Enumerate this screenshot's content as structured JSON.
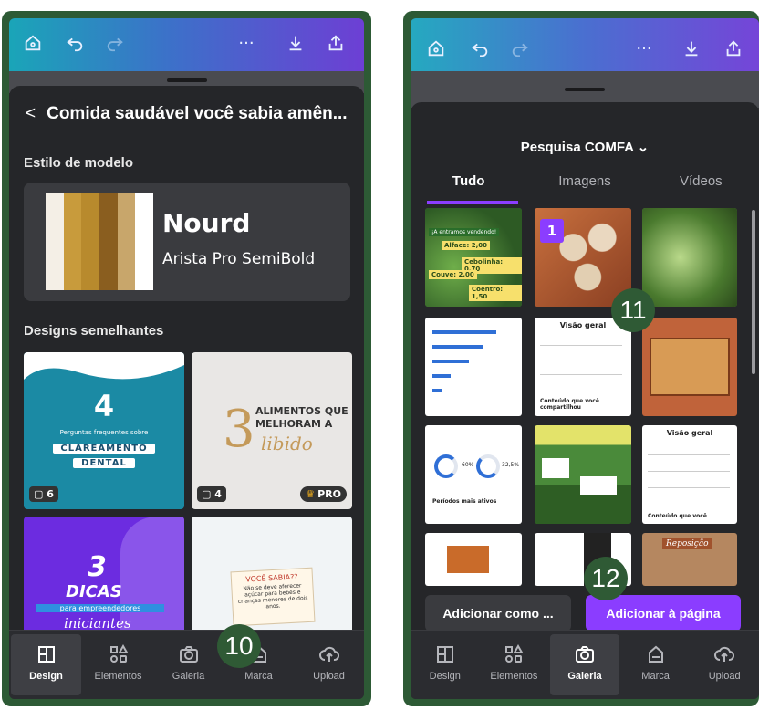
{
  "left": {
    "appbar_icons": [
      "home-icon",
      "undo-icon",
      "redo-icon",
      "more-icon",
      "download-icon",
      "share-icon"
    ],
    "more_glyph": "···",
    "title": "Comida saudável você sabia amên...",
    "back_glyph": "<",
    "style_section": "Estilo de modelo",
    "style_name": "Nourd",
    "style_font": "Arista Pro SemiBold",
    "swatch_colors": [
      "#f4efe6",
      "#c89b3c",
      "#b88a2d",
      "#8a5e1f",
      "#c8a66b",
      "#ffffff"
    ],
    "similar_section": "Designs semelhantes",
    "tiles": [
      {
        "title_num": "4",
        "subtitle": "Perguntas frequentes sobre",
        "label1": "CLAREAMENTO",
        "label2": "DENTAL",
        "badge": "6",
        "bg": "#1b8aa4"
      },
      {
        "title_num": "3",
        "line1": "ALIMENTOS QUE",
        "line2": "MELHORAM A",
        "line3": "libido",
        "badge": "4",
        "pro": "PRO",
        "bg": "#e9e7e5"
      },
      {
        "title_num": "3",
        "line1": "DICAS",
        "line2": "para empreendedores",
        "line3": "iniciantes",
        "bg": "#6c2ce0"
      },
      {
        "label": "VOCÊ SABIA??",
        "text": "Não se deve aferecer açúcar para bebês e crianças menores de dois anos.",
        "bg": "#f1f4f6"
      }
    ],
    "tabs": [
      {
        "label": "Design",
        "icon": "layout-icon",
        "active": true
      },
      {
        "label": "Elementos",
        "icon": "shapes-icon",
        "active": false
      },
      {
        "label": "Galeria",
        "icon": "camera-icon",
        "active": false
      },
      {
        "label": "Marca",
        "icon": "brand-icon",
        "active": false
      },
      {
        "label": "Upload",
        "icon": "upload-cloud-icon",
        "active": false
      }
    ],
    "marker": "10"
  },
  "right": {
    "search_title": "Pesquisa COMFA",
    "chevron": "⌄",
    "filter_tabs": [
      "Tudo",
      "Imagens",
      "Vídeos"
    ],
    "active_filter": "Tudo",
    "row1_overlay": {
      "heading": "¡A entramos vendendo!",
      "items": [
        "Alface: 2,00",
        "Cebolinha: 0,70",
        "Couve: 2,00",
        "Coentro: 1,50"
      ]
    },
    "selected_number": "1",
    "overview_title": "Visão geral",
    "overview_footer": "Conteúdo que você compartilhou",
    "overview_footer2": "Conteúdo que você",
    "stats_values": [
      "60%",
      "32,5%"
    ],
    "stats_footer": "Períodos mais ativos",
    "reposicao": "Reposição",
    "add_as": "Adicionar como ...",
    "add_page": "Adicionar à página",
    "tabs": [
      {
        "label": "Design",
        "icon": "layout-icon",
        "active": false
      },
      {
        "label": "Elementos",
        "icon": "shapes-icon",
        "active": false
      },
      {
        "label": "Galeria",
        "icon": "camera-icon",
        "active": true
      },
      {
        "label": "Marca",
        "icon": "brand-icon",
        "active": false
      },
      {
        "label": "Upload",
        "icon": "upload-cloud-icon",
        "active": false
      }
    ],
    "marker_top": "11",
    "marker_bottom": "12"
  }
}
